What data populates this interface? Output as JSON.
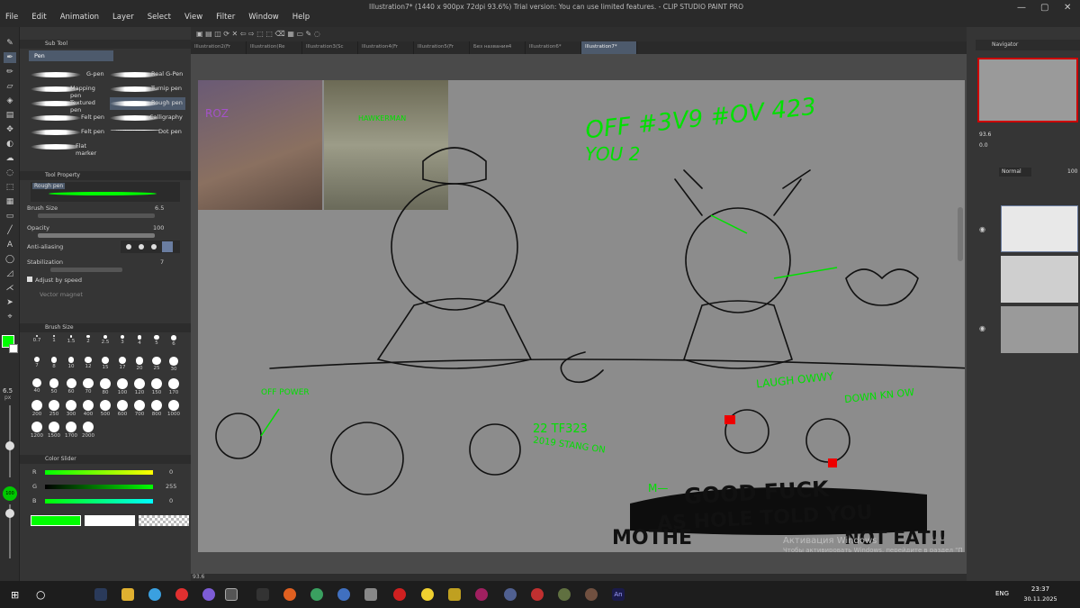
{
  "window": {
    "title": "Illustration7* (1440 x 900px 72dpi 93.6%)  Trial version: You can use limited features. - CLIP STUDIO PAINT PRO",
    "menu": [
      "File",
      "Edit",
      "Animation",
      "Layer",
      "Select",
      "View",
      "Filter",
      "Window",
      "Help"
    ]
  },
  "tabs": [
    {
      "label": "Illustration2(Fr"
    },
    {
      "label": "Illustration(Re"
    },
    {
      "label": "Illustration3(Sc"
    },
    {
      "label": "Illustration4(Fr"
    },
    {
      "label": "Illustration5(Fr"
    },
    {
      "label": "Без названия4"
    },
    {
      "label": "Illustration6*"
    },
    {
      "label": "Illustration7*"
    }
  ],
  "subtool": {
    "header": "Sub Tool",
    "group": "Pen",
    "brushes": [
      {
        "label": "G-pen"
      },
      {
        "label": "Real G-Pen"
      },
      {
        "label": "Mapping pen"
      },
      {
        "label": "Turnip pen"
      },
      {
        "label": "Textured pen"
      },
      {
        "label": "Rough pen"
      },
      {
        "label": "Felt pen"
      },
      {
        "label": "Calligraphy"
      },
      {
        "label": "Felt pen"
      },
      {
        "label": "Dot pen"
      },
      {
        "label": "Flat marker"
      }
    ]
  },
  "toolprop": {
    "header": "Tool Property",
    "current": "Rough pen",
    "brush_size_label": "Brush Size",
    "brush_size_value": "6.5",
    "opacity_label": "Opacity",
    "opacity_value": "100",
    "antialias_label": "Anti-aliasing",
    "stabilization_label": "Stabilization",
    "stabilization_value": "7",
    "adjust_speed": "Adjust by speed",
    "vector_magnet": "Vector magnet"
  },
  "brushsize": {
    "header": "Brush Size",
    "sizes": [
      "0.7",
      "1",
      "1.5",
      "2",
      "2.5",
      "3",
      "4",
      "5",
      "6",
      "7",
      "8",
      "10",
      "12",
      "15",
      "17",
      "20",
      "25",
      "30",
      "40",
      "50",
      "60",
      "70",
      "80",
      "100",
      "120",
      "150",
      "170",
      "200",
      "250",
      "300",
      "400",
      "500",
      "600",
      "700",
      "800",
      "1000",
      "1200",
      "1500",
      "1700",
      "2000"
    ]
  },
  "colorslider": {
    "header": "Color Slider",
    "r_label": "R",
    "r_value": "0",
    "g_label": "G",
    "g_value": "255",
    "b_label": "B",
    "b_value": "0",
    "main_color": "#00ff00",
    "sub_color": "#ffffff"
  },
  "leftsize": {
    "value": "6.5",
    "unit": "px",
    "opacity": "100"
  },
  "navigator": {
    "header": "Navigator",
    "zoom": "93.6",
    "rotate": "0.0"
  },
  "layers": {
    "blend_mode": "Normal",
    "opacity": "100"
  },
  "status": {
    "zoom": "93.6"
  },
  "canvas_text": {
    "green_top": "OFF #3V9 #OV 423",
    "green_top2": "YOU 2",
    "photo_left": "ROZ",
    "photo_right": "HAWKERMAN",
    "off_power": "OFF POWER",
    "gold_22": "22 TF323",
    "gold_2019": "2019 STANG ON",
    "laugh": "LAUGH OWWY",
    "down": "DOWN KN OW",
    "m_dash": "M—",
    "good": "GOOD FUCK",
    "hole": "AS HOLE TOLD YOU",
    "mothe": "MOTHE",
    "not_eat": "NOT EAT!!"
  },
  "activation": {
    "line1": "Активация Windows",
    "line2": "Чтобы активировать Windows, перейдите в раздел \"Параметры\"."
  },
  "taskbar": {
    "lang": "ENG",
    "time": "23:37",
    "date": "30.11.2025"
  }
}
